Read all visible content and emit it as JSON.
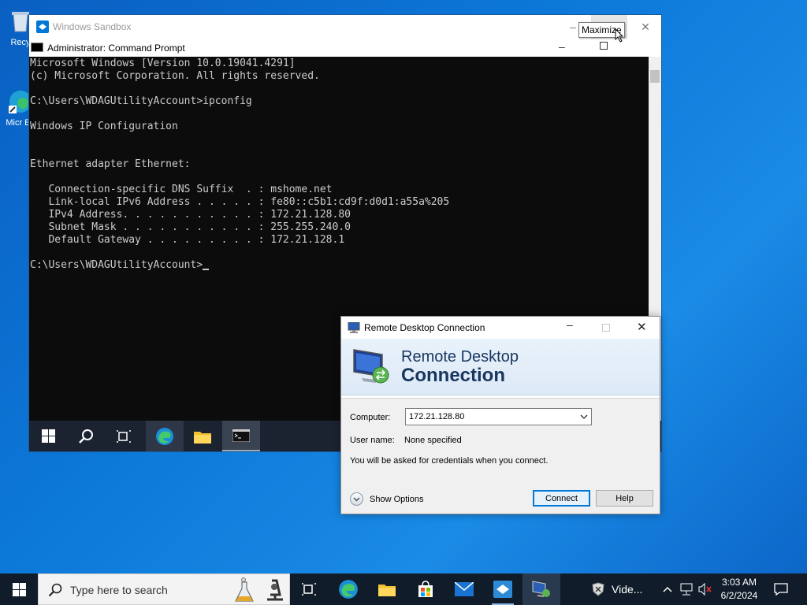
{
  "desktop": {
    "icons": [
      {
        "label": "Recy"
      },
      {
        "label": "Micr Ed"
      }
    ]
  },
  "sandbox": {
    "title": "Windows Sandbox",
    "controls": {
      "minimize": "–",
      "maximize": "☐",
      "close": "✕"
    },
    "tooltip": "Maximize"
  },
  "cmd": {
    "title": "Administrator: Command Prompt",
    "lines": [
      "Microsoft Windows [Version 10.0.19041.4291]",
      "(c) Microsoft Corporation. All rights reserved.",
      "",
      "C:\\Users\\WDAGUtilityAccount>ipconfig",
      "",
      "Windows IP Configuration",
      "",
      "",
      "Ethernet adapter Ethernet:",
      "",
      "   Connection-specific DNS Suffix  . : mshome.net",
      "   Link-local IPv6 Address . . . . . : fe80::c5b1:cd9f:d0d1:a55a%205",
      "   IPv4 Address. . . . . . . . . . . : 172.21.128.80",
      "   Subnet Mask . . . . . . . . . . . : 255.255.240.0",
      "   Default Gateway . . . . . . . . . : 172.21.128.1",
      ""
    ],
    "prompt": "C:\\Users\\WDAGUtilityAccount>"
  },
  "rdc": {
    "title": "Remote Desktop Connection",
    "brand_line1": "Remote Desktop",
    "brand_line2": "Connection",
    "computer_label": "Computer:",
    "computer_value": "172.21.128.80",
    "username_label": "User name:",
    "username_value": "None specified",
    "credentials_note": "You will be asked for credentials when you connect.",
    "show_options": "Show Options",
    "connect": "Connect",
    "help": "Help",
    "controls": {
      "minimize": "–",
      "close": "✕"
    }
  },
  "taskbar": {
    "search_placeholder": "Type here to search",
    "news": "Vide...",
    "time": "3:03 AM",
    "date": "6/2/2024"
  },
  "colors": {
    "accent": "#0078d7",
    "desktop": "#0c78d8",
    "taskbar": "#101c2a",
    "console_text": "#cccccc"
  }
}
